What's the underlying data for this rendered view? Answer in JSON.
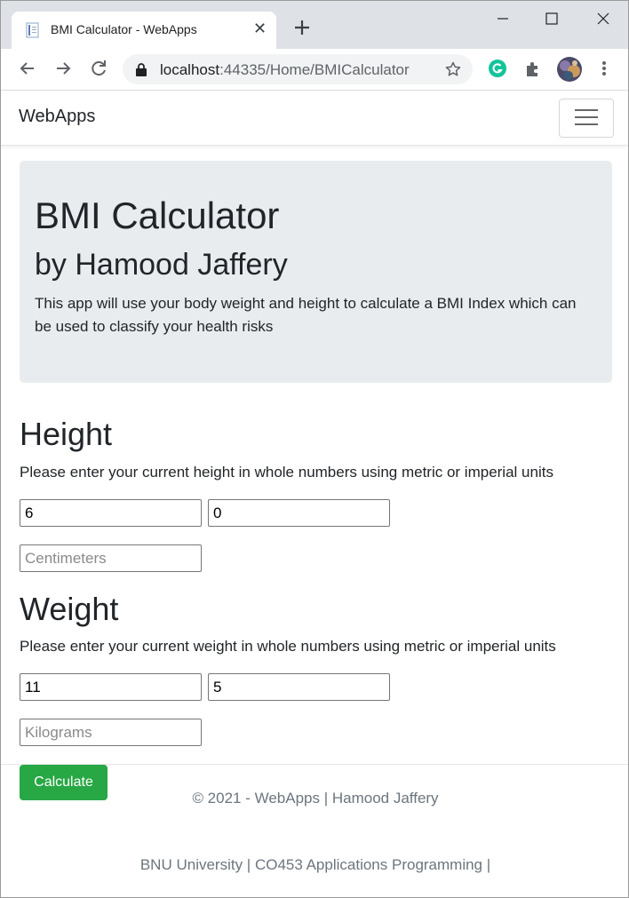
{
  "browser": {
    "tab_title": "BMI Calculator - WebApps",
    "url_host": "localhost",
    "url_path": ":44335/Home/BMICalculator",
    "icons": [
      "favicon-icon",
      "close-icon",
      "new-tab-icon",
      "minimize-icon",
      "maximize-icon",
      "close-window-icon",
      "back-icon",
      "forward-icon",
      "reload-icon",
      "lock-icon",
      "bookmark-star-icon",
      "grammarly-icon",
      "extensions-puzzle-icon",
      "profile-avatar",
      "menu-dots-icon"
    ]
  },
  "navbar": {
    "brand": "WebApps"
  },
  "jumbotron": {
    "title": "BMI Calculator",
    "subtitle": "by Hamood Jaffery",
    "description": "This app will use your body weight and height to calculate a BMI Index which can be used to classify your health risks"
  },
  "height": {
    "heading": "Height",
    "instructions": "Please enter your current height in whole numbers using metric or imperial units",
    "feet_value": "6",
    "inches_value": "0",
    "cm_placeholder": "Centimeters"
  },
  "weight": {
    "heading": "Weight",
    "instructions": "Please enter your current weight in whole numbers using metric or imperial units",
    "stone_value": "11",
    "pounds_value": "5",
    "kg_placeholder": "Kilograms"
  },
  "actions": {
    "calculate_label": "Calculate"
  },
  "footer": {
    "copyright": "© 2021 - WebApps | Hamood Jaffery",
    "university": "BNU University | CO453 Applications Programming |"
  },
  "colors": {
    "tabstrip": "#dee1e6",
    "jumbotron": "#e9ecef",
    "button": "#28a745",
    "grammarly": "#15c39a"
  }
}
